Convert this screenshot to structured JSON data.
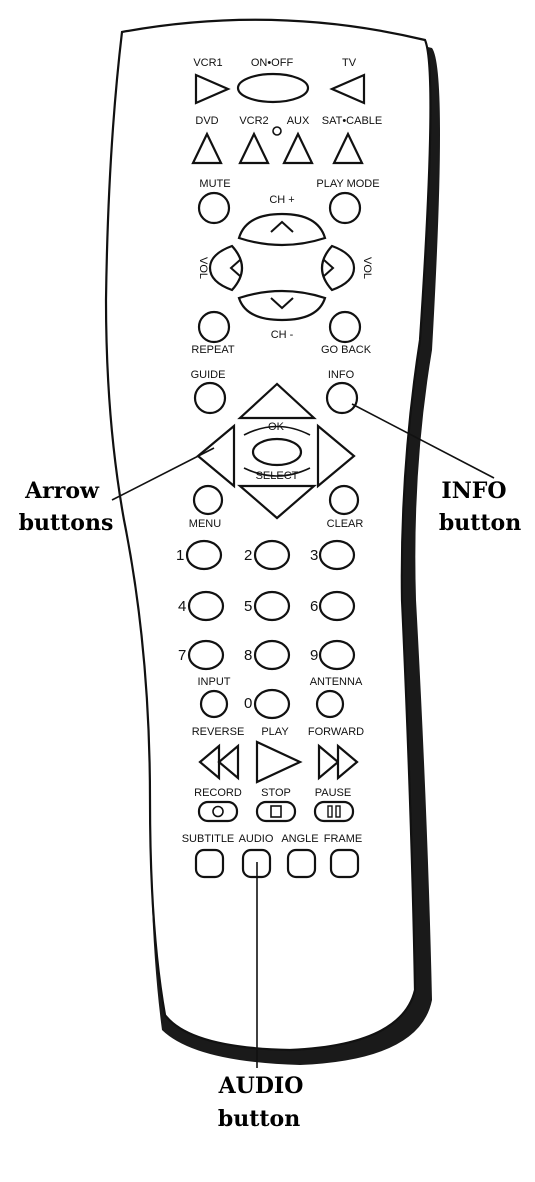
{
  "labels": {
    "vcr1": "VCR1",
    "on_off": "ON•OFF",
    "tv": "TV",
    "dvd": "DVD",
    "vcr2": "VCR2",
    "aux": "AUX",
    "sat_cable": "SAT•CABLE",
    "mute": "MUTE",
    "ch_plus": "CH +",
    "play_mode": "PLAY MODE",
    "vol_left": "VOL",
    "vol_right": "VOL",
    "ch_minus": "CH -",
    "repeat": "REPEAT",
    "go_back": "GO BACK",
    "guide": "GUIDE",
    "info": "INFO",
    "ok": "OK",
    "select": "SELECT",
    "menu": "MENU",
    "clear": "CLEAR",
    "input": "INPUT",
    "antenna": "ANTENNA",
    "reverse": "REVERSE",
    "play": "PLAY",
    "forward": "FORWARD",
    "record": "RECORD",
    "stop": "STOP",
    "pause": "PAUSE",
    "subtitle": "SUBTITLE",
    "audio": "AUDIO",
    "angle": "ANGLE",
    "frame": "FRAME"
  },
  "digits": [
    "1",
    "2",
    "3",
    "4",
    "5",
    "6",
    "7",
    "8",
    "9",
    "0"
  ],
  "callouts": {
    "arrow_line1": "Arrow",
    "arrow_line2": "buttons",
    "info_line1": "INFO",
    "info_line2": "button",
    "audio_line1": "AUDIO",
    "audio_line2": "button"
  }
}
